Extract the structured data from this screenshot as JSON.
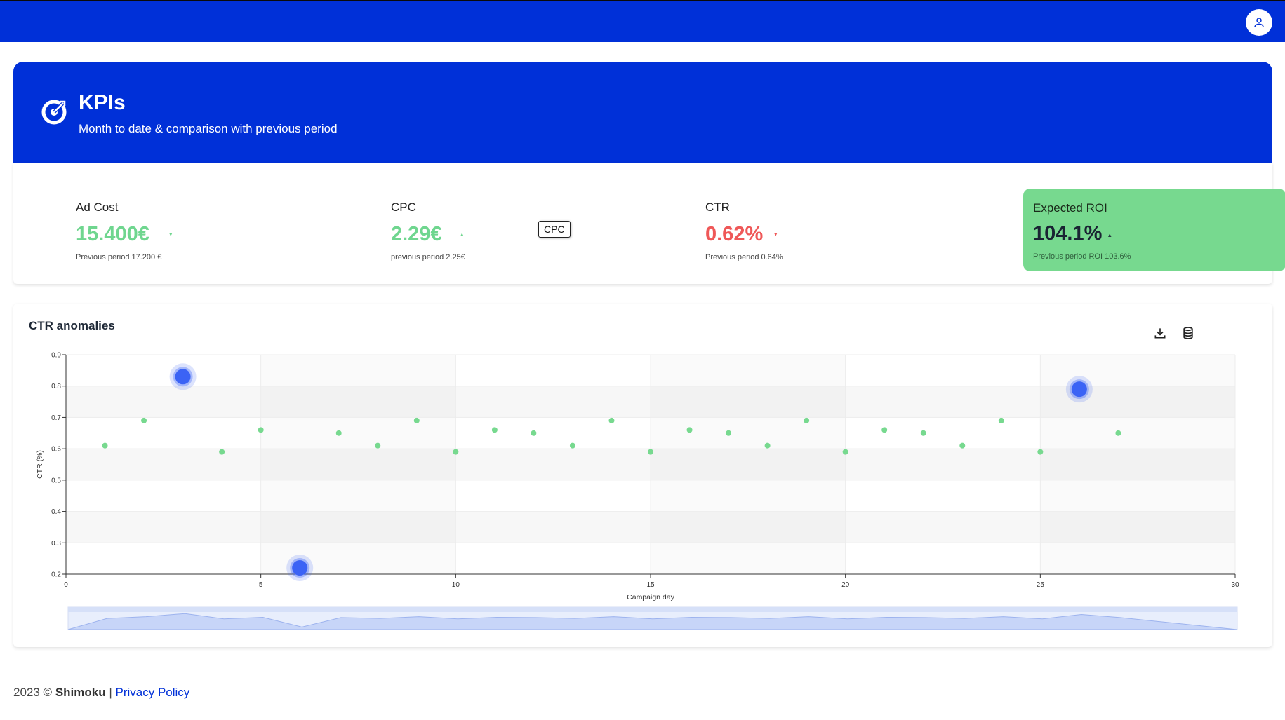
{
  "header": {
    "avatar_icon": "user-icon",
    "bar_color": "#0030d8"
  },
  "hero": {
    "icon": "target-icon",
    "title": "KPIs",
    "subtitle": "Month to date & comparison with previous period"
  },
  "kpis": [
    {
      "label": "Ad Cost",
      "value": "15.400€",
      "trend": "down",
      "trend_glyph": "▾",
      "color": "#6fd68f",
      "previous": "Previous period 17.200 €"
    },
    {
      "label": "CPC",
      "value": "2.29€",
      "trend": "up",
      "trend_glyph": "▴",
      "color": "#6fd68f",
      "previous": "previous period 2.25€"
    },
    {
      "label": "CTR",
      "value": "0.62%",
      "trend": "down",
      "trend_glyph": "▾",
      "color": "#ef5858",
      "previous": "Previous period 0.64%"
    },
    {
      "label": "Expected ROI",
      "value": "104.1%",
      "trend": "up",
      "trend_glyph": "▴",
      "color": "#77d98f",
      "previous": "Previous period ROI 103.6%"
    }
  ],
  "tooltip": {
    "text": "CPC"
  },
  "chart": {
    "title": "CTR anomalies",
    "download_icon": "download-icon",
    "data_icon": "database-icon"
  },
  "chart_data": {
    "type": "scatter",
    "title": "CTR anomalies",
    "xlabel": "Campaign day",
    "ylabel": "CTR (%)",
    "xlim": [
      0,
      30
    ],
    "ylim": [
      0.2,
      0.9
    ],
    "x_ticks": [
      0,
      5,
      10,
      15,
      20,
      25,
      30
    ],
    "y_ticks": [
      0.2,
      0.3,
      0.4,
      0.5,
      0.6,
      0.7,
      0.8,
      0.9
    ],
    "grid": true,
    "series": [
      {
        "role": "normal",
        "color": "#77d98f",
        "points": [
          [
            1,
            0.61
          ],
          [
            2,
            0.69
          ],
          [
            4,
            0.59
          ],
          [
            5,
            0.66
          ],
          [
            7,
            0.65
          ],
          [
            8,
            0.61
          ],
          [
            9,
            0.69
          ],
          [
            10,
            0.59
          ],
          [
            11,
            0.66
          ],
          [
            12,
            0.65
          ],
          [
            13,
            0.61
          ],
          [
            14,
            0.69
          ],
          [
            15,
            0.59
          ],
          [
            16,
            0.66
          ],
          [
            17,
            0.65
          ],
          [
            18,
            0.61
          ],
          [
            19,
            0.69
          ],
          [
            20,
            0.59
          ],
          [
            21,
            0.66
          ],
          [
            22,
            0.65
          ],
          [
            23,
            0.61
          ],
          [
            24,
            0.69
          ],
          [
            25,
            0.59
          ],
          [
            27,
            0.65
          ]
        ]
      },
      {
        "role": "anomaly",
        "color": "#3b63f5",
        "points": [
          [
            3,
            0.83
          ],
          [
            6,
            0.22
          ],
          [
            26,
            0.79
          ]
        ]
      }
    ],
    "data_zoom": {
      "start": 0,
      "end": 30
    }
  },
  "footer": {
    "year_text": "2023 ©",
    "brand": "Shimoku",
    "separator": "|",
    "privacy_link": "Privacy Policy"
  }
}
